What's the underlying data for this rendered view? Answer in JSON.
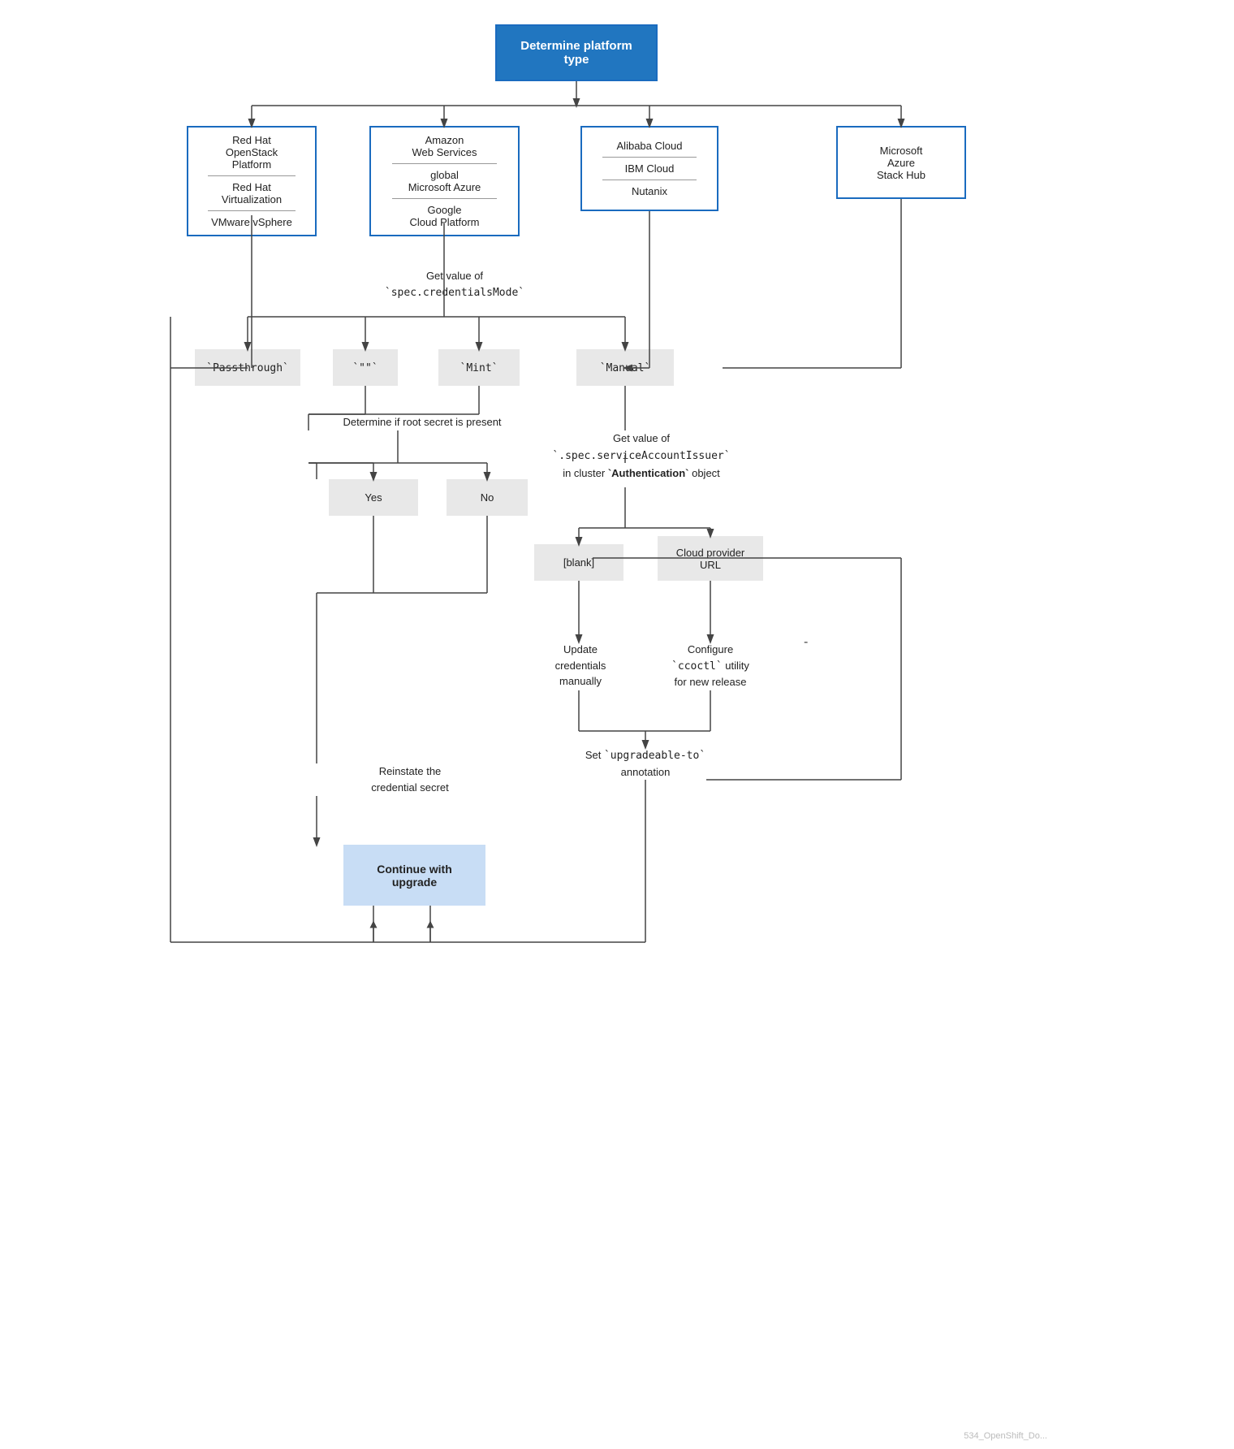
{
  "diagram": {
    "title": "Determine platform type",
    "platforms": {
      "left": {
        "items": [
          "Red Hat OpenStack Platform",
          "Red Hat Virtualization",
          "VMware vSphere"
        ],
        "dividers": [
          true,
          true
        ]
      },
      "aws": {
        "items": [
          "Amazon Web Services",
          "global Microsoft Azure",
          "Google Cloud Platform"
        ],
        "dividers": [
          true,
          true
        ]
      },
      "alibaba": {
        "items": [
          "Alibaba Cloud",
          "IBM Cloud",
          "Nutanix"
        ],
        "dividers": [
          true,
          true
        ]
      },
      "azure": {
        "label": "Microsoft Azure Stack Hub"
      }
    },
    "credentialsMode": {
      "label": "Get value of\n`spec.credentialsMode`",
      "options": [
        "`Passthrough`",
        "`\"\"`",
        "`Mint`",
        "`Manual`"
      ]
    },
    "rootSecret": {
      "label": "Determine if root secret is present",
      "options": [
        "Yes",
        "No"
      ]
    },
    "serviceAccountIssuer": {
      "label": "Get value of\n`.spec.serviceAccountIssuer`\nin cluster `Authentication` object",
      "options": [
        "[blank]",
        "Cloud provider URL"
      ]
    },
    "actions": {
      "reinstate": "Reinstate the\ncredential secret",
      "continueUpgrade": "Continue\nwith upgrade",
      "updateCredentials": "Update\ncredentials\nmanually",
      "configureCcoctl": "Configure\n`ccoctl` utility\nfor new release",
      "setAnnotation": "Set `upgradeable-to`\nannotation"
    },
    "watermark": "534_OpenShift_Do..."
  }
}
